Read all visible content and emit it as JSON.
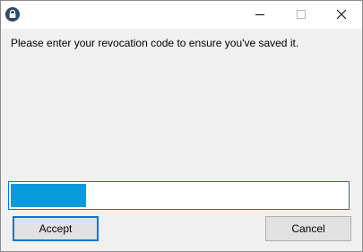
{
  "window": {
    "icon": "lock-icon",
    "controls": [
      "minimize-icon",
      "maximize-icon",
      "close-icon"
    ]
  },
  "dialog": {
    "message": "Please enter your revocation code to ensure you've saved it.",
    "code_field": {
      "value": "",
      "placeholder": ""
    },
    "accept_label": "Accept",
    "cancel_label": "Cancel"
  },
  "colors": {
    "accent": "#0078d7",
    "selection": "#0a9bdc",
    "dialog_background": "#f0f0f0"
  }
}
